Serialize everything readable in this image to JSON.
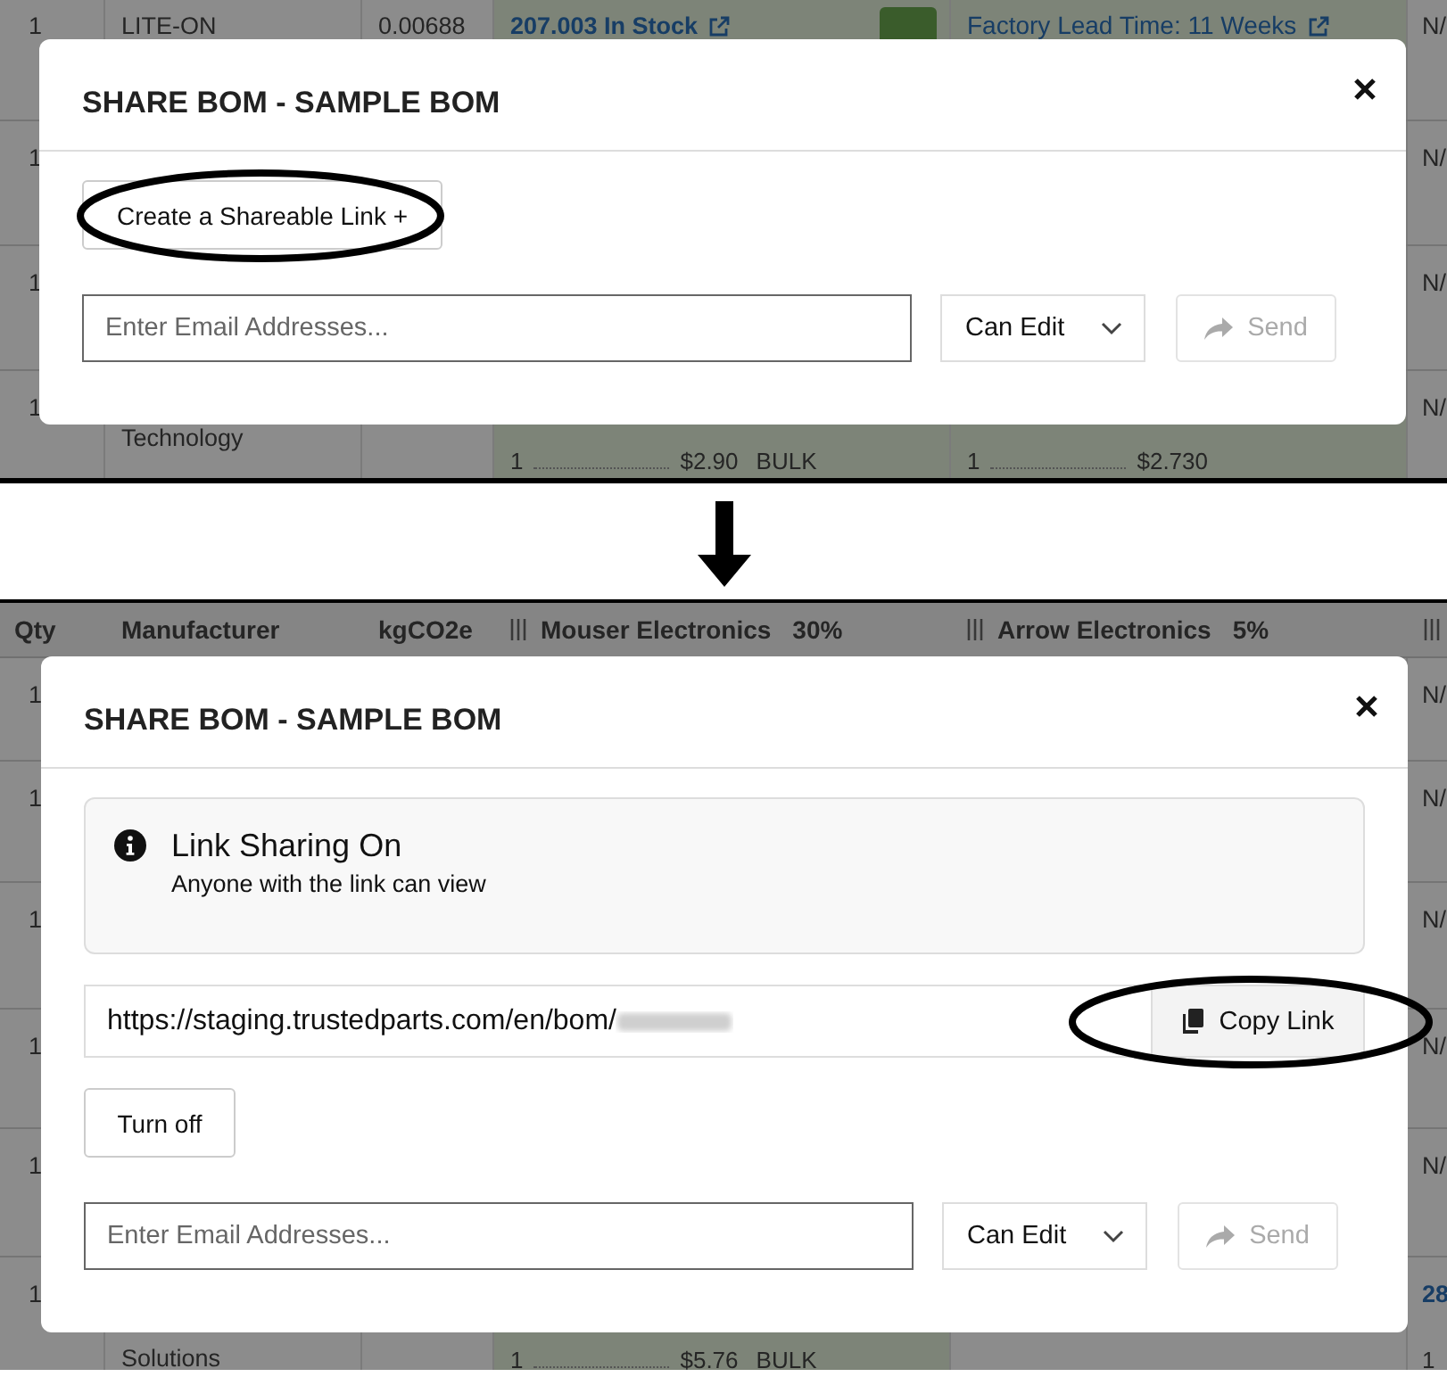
{
  "before": {
    "table": {
      "rows": [
        {
          "qty": "1",
          "manufacturer": "LITE-ON",
          "kgco2e": "0.00688",
          "mouser": {
            "kind": "stock",
            "text": "207.003 In Stock",
            "cart_button": true
          },
          "arrow": {
            "kind": "link",
            "text": "Factory Lead Time: 11 Weeks"
          },
          "column_6": "N/"
        },
        {
          "qty": "1",
          "column_6": "N/"
        },
        {
          "qty": "1",
          "column_6": "N/"
        },
        {
          "qty": "1",
          "manufacturer": {
            "kind": "continued",
            "text": "Technology"
          },
          "mouser": {
            "kind": "price",
            "quantity": "1",
            "price": "$2.90",
            "package": "BULK"
          },
          "arrow": {
            "kind": "price",
            "quantity": "1",
            "price": "$2.730"
          },
          "column_6": "N/"
        }
      ]
    },
    "dialog": {
      "title": "SHARE BOM - SAMPLE BOM",
      "sections": [
        {
          "kind": "create-link",
          "label": "Create a Shareable Link +",
          "circled": true
        },
        {
          "kind": "invite",
          "placeholder": "Enter Email Addresses...",
          "permission": "Can Edit",
          "send": "Send",
          "send_disabled": true
        }
      ]
    }
  },
  "after": {
    "table": {
      "header": [
        {
          "kind": "label",
          "text": "Qty"
        },
        {
          "kind": "label",
          "text": "Manufacturer"
        },
        {
          "kind": "label",
          "text": "kgCO2e"
        },
        {
          "kind": "supplier",
          "name": "Mouser Electronics",
          "share": "30%"
        },
        {
          "kind": "supplier",
          "name": "Arrow Electronics",
          "share": "5%"
        },
        {
          "kind": "supplier"
        }
      ],
      "rows": [
        {
          "qty": "1",
          "column_6": "N/"
        },
        {
          "qty": "1",
          "column_6": "N/"
        },
        {
          "qty": "1",
          "column_6": "N/"
        },
        {
          "qty": "1",
          "column_6": "N/"
        },
        {
          "qty": "1",
          "column_6": "N/"
        },
        {
          "qty": "1",
          "manufacturer": {
            "kind": "continued",
            "text": "Solutions"
          },
          "mouser": {
            "kind": "price",
            "quantity": "1",
            "price": "$5.76",
            "package": "BULK"
          },
          "column_6": [
            {
              "kind": "stock",
              "text": "28"
            },
            {
              "kind": "price",
              "quantity": "1"
            }
          ]
        }
      ]
    },
    "dialog": {
      "title": "SHARE BOM - SAMPLE BOM",
      "sections": [
        {
          "kind": "notice",
          "title": "Link Sharing On",
          "text": "Anyone with the link can view"
        },
        {
          "kind": "link-field",
          "url": "https://staging.trustedparts.com/en/bom/",
          "copy": "Copy Link",
          "circled": true
        },
        {
          "kind": "turn-off",
          "label": "Turn off"
        },
        {
          "kind": "invite",
          "placeholder": "Enter Email Addresses...",
          "permission": "Can Edit",
          "send": "Send",
          "send_disabled": true
        }
      ]
    }
  }
}
